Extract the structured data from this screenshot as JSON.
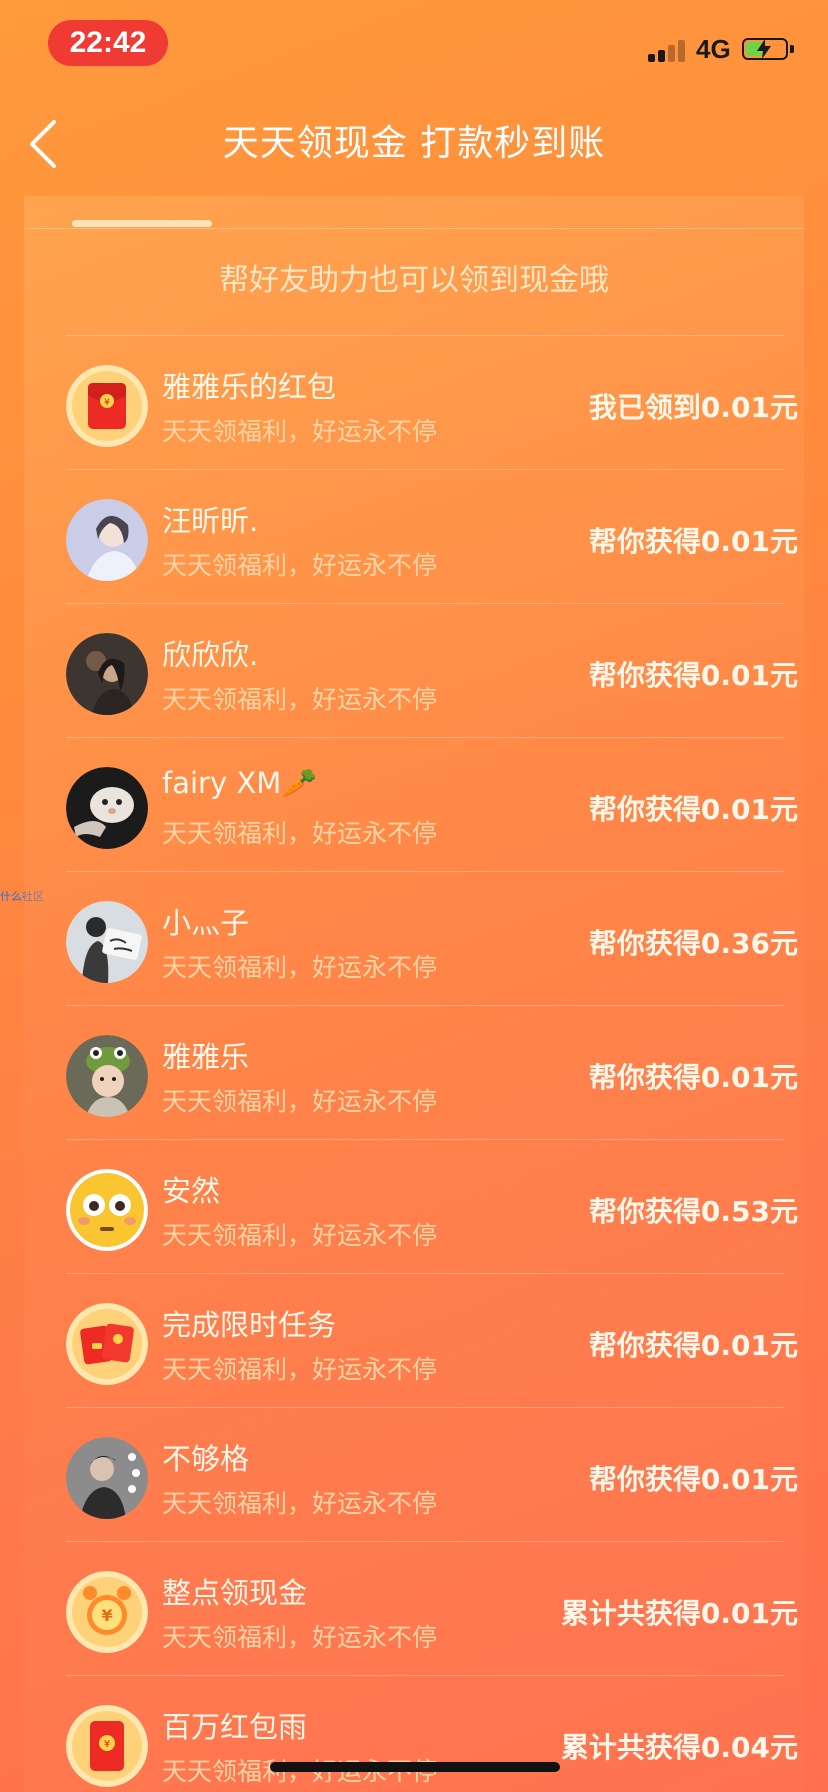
{
  "status_bar": {
    "time": "22:42",
    "network": "4G",
    "signal_bars": 2,
    "battery_fraction": 0.45,
    "icons": [
      "signal-icon",
      "battery-charging-icon"
    ]
  },
  "nav": {
    "title": "天天领现金 打款秒到账",
    "back_icon": "chevron-left-icon"
  },
  "tip": "帮好友助力也可以领到现金哦",
  "side_tag": "什么社区",
  "rows": [
    {
      "name": "雅雅乐的红包",
      "subtitle": "天天领福利，好运永不停",
      "amount": "我已领到0.01元",
      "avatar": "red-envelope-icon"
    },
    {
      "name": "汪昕昕.",
      "subtitle": "天天领福利，好运永不停",
      "amount": "帮你获得0.01元",
      "avatar": "user-photo"
    },
    {
      "name": "欣欣欣.",
      "subtitle": "天天领福利，好运永不停",
      "amount": "帮你获得0.01元",
      "avatar": "user-photo"
    },
    {
      "name": "fairy XM🥕",
      "subtitle": "天天领福利，好运永不停",
      "amount": "帮你获得0.01元",
      "avatar": "user-photo"
    },
    {
      "name": "小灬子",
      "subtitle": "天天领福利，好运永不停",
      "amount": "帮你获得0.36元",
      "avatar": "user-photo"
    },
    {
      "name": "雅雅乐",
      "subtitle": "天天领福利，好运永不停",
      "amount": "帮你获得0.01元",
      "avatar": "user-photo"
    },
    {
      "name": "安然",
      "subtitle": "天天领福利，好运永不停",
      "amount": "帮你获得0.53元",
      "avatar": "flushed-face-emoji-icon"
    },
    {
      "name": "完成限时任务",
      "subtitle": "天天领福利，好运永不停",
      "amount": "帮你获得0.01元",
      "avatar": "red-envelopes-icon"
    },
    {
      "name": "不够格",
      "subtitle": "天天领福利，好运永不停",
      "amount": "帮你获得0.01元",
      "avatar": "user-photo"
    },
    {
      "name": "整点领现金",
      "subtitle": "天天领福利，好运永不停",
      "amount": "累计共获得0.01元",
      "avatar": "alarm-clock-coin-icon"
    },
    {
      "name": "百万红包雨",
      "subtitle": "天天领福利，好运永不停",
      "amount": "累计共获得0.04元",
      "avatar": "red-envelope-icon"
    }
  ]
}
